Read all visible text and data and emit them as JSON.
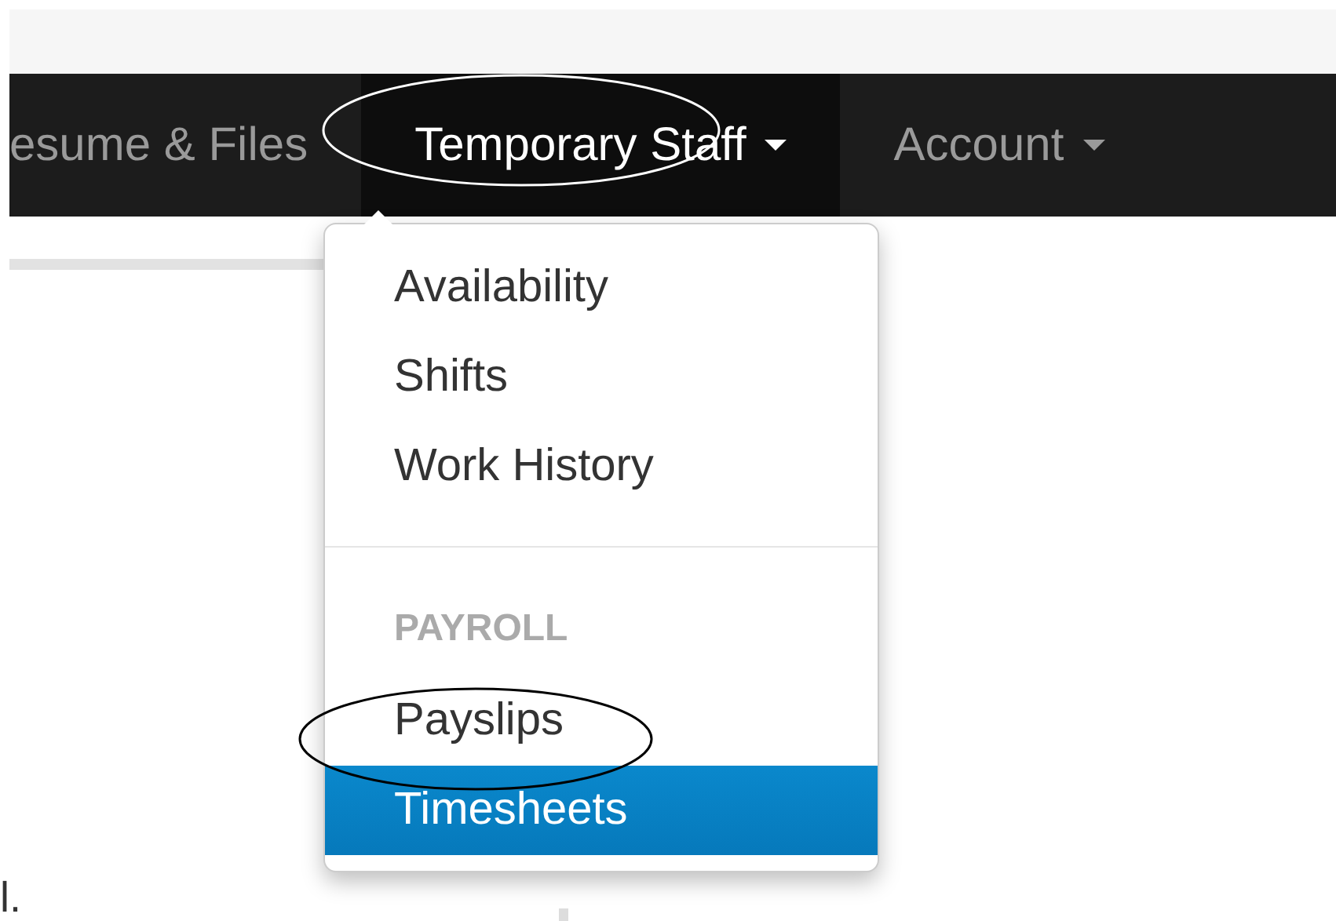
{
  "navbar": {
    "items": [
      {
        "label": "esume & Files",
        "selected": false,
        "has_caret": false,
        "circled": false
      },
      {
        "label": "Temporary Staff",
        "selected": true,
        "has_caret": true,
        "circled": true
      },
      {
        "label": "Account",
        "selected": false,
        "has_caret": true,
        "circled": false
      }
    ]
  },
  "dropdown": {
    "items": [
      {
        "kind": "item",
        "label": "Availability",
        "selected": false,
        "circled": false
      },
      {
        "kind": "item",
        "label": "Shifts",
        "selected": false,
        "circled": false
      },
      {
        "kind": "item",
        "label": "Work History",
        "selected": false,
        "circled": false
      },
      {
        "kind": "divider"
      },
      {
        "kind": "header",
        "label": "PAYROLL"
      },
      {
        "kind": "item",
        "label": "Payslips",
        "selected": false,
        "circled": true
      },
      {
        "kind": "item",
        "label": "Timesheets",
        "selected": true,
        "circled": false
      }
    ]
  },
  "body_text": "l."
}
